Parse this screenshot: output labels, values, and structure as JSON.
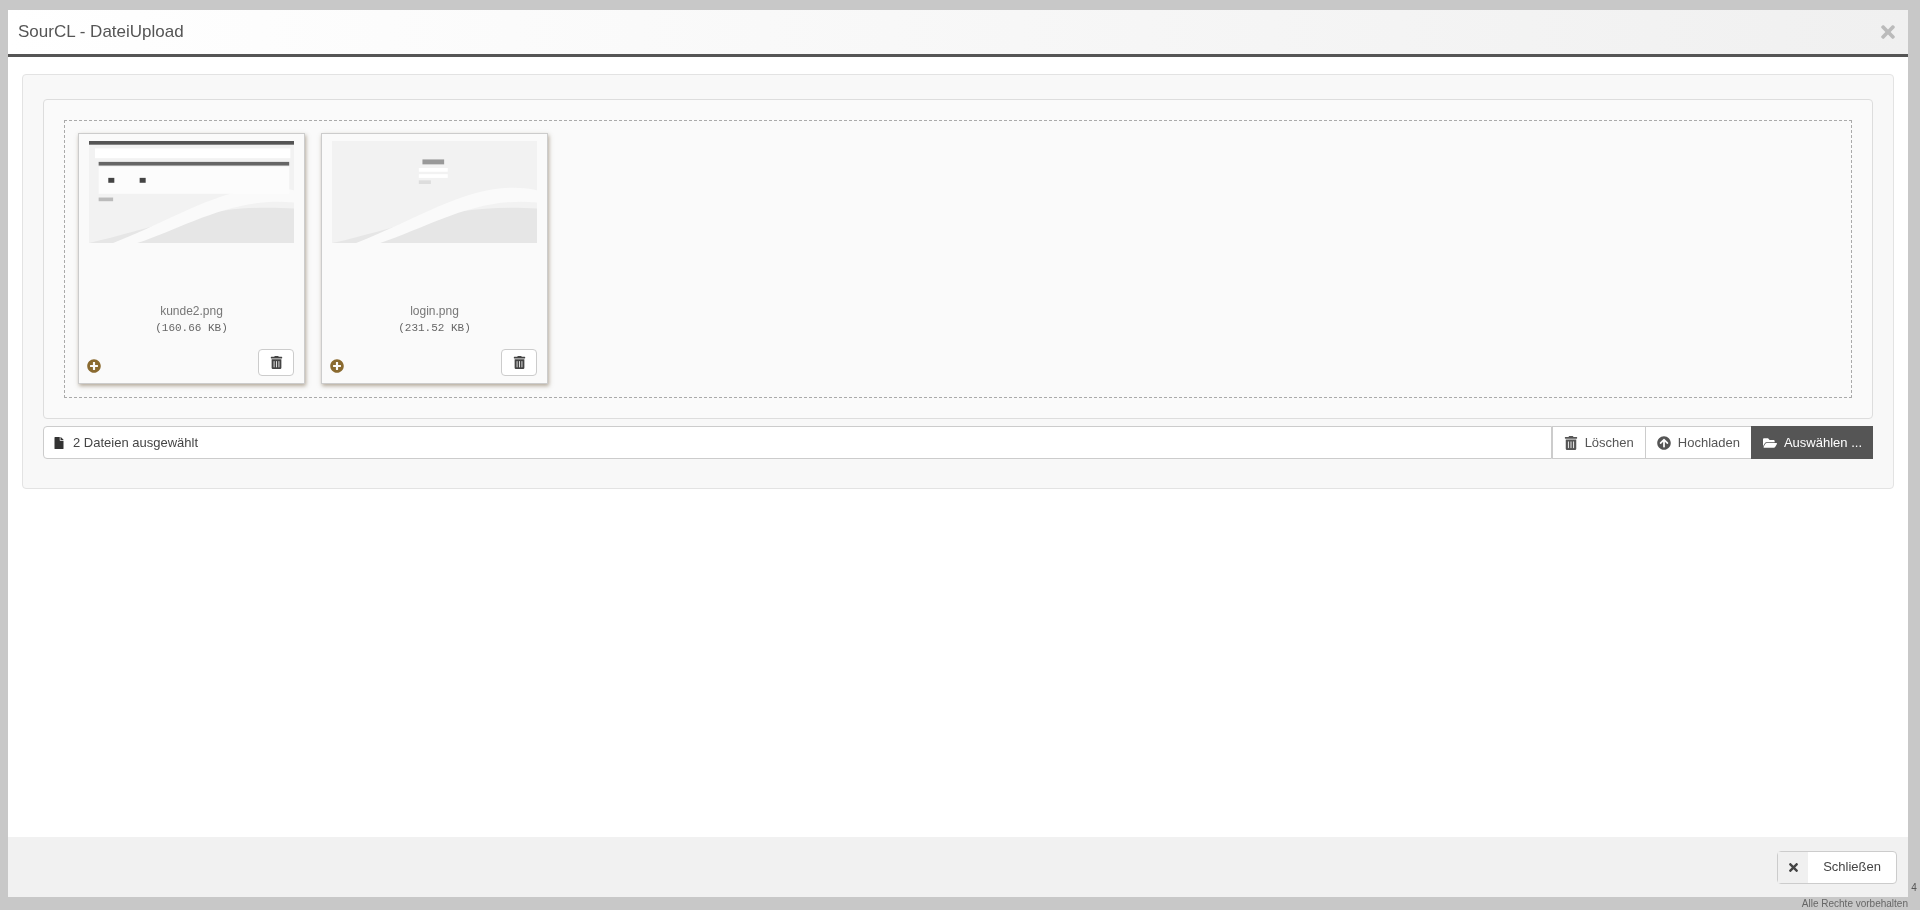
{
  "window": {
    "title": "SourCL - DateiUpload"
  },
  "files": [
    {
      "name": "kunde2.png",
      "size": "(160.66 KB)",
      "kind": "app"
    },
    {
      "name": "login.png",
      "size": "(231.52 KB)",
      "kind": "login"
    }
  ],
  "file_input": {
    "value": "2 Dateien ausgewählt"
  },
  "buttons": [
    {
      "label": "Löschen",
      "kind": "remove"
    },
    {
      "label": "Hochladen",
      "kind": "upload"
    },
    {
      "label": "Auswählen ...",
      "kind": "browse"
    }
  ],
  "footer_buttons": [
    {
      "label": "Schließen",
      "kind": "close"
    }
  ],
  "background": {
    "page_number": "4",
    "copyright": "Alle Rechte vorbehalten"
  }
}
